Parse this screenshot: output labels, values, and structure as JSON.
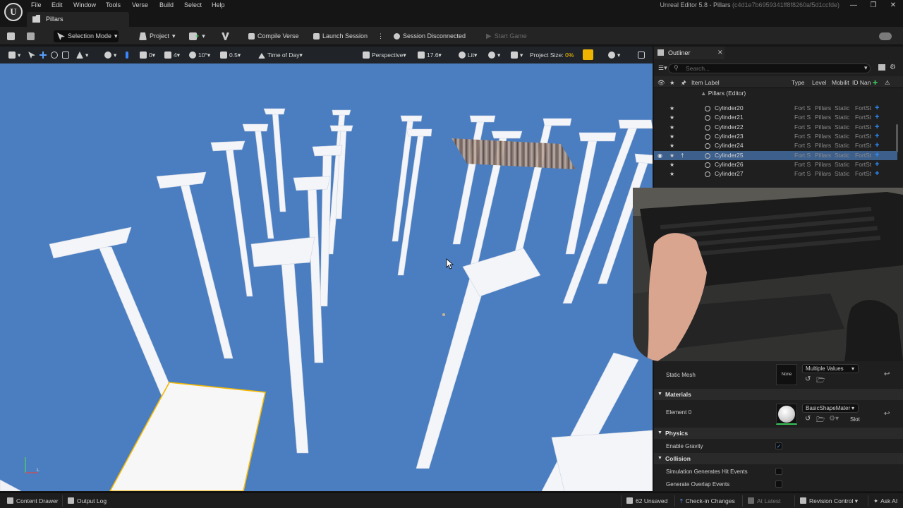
{
  "app": {
    "window_title": "Unreal Editor 5.8 - Pillars",
    "window_hash": "(c4d1e7b6959341ff8f8260af5d1ccfde)",
    "logo_text": "U"
  },
  "menu": {
    "items": [
      "File",
      "Edit",
      "Window",
      "Tools",
      "Verse",
      "Build",
      "Select",
      "Help"
    ]
  },
  "level_tab": {
    "label": "Pillars"
  },
  "toolbar": {
    "mode_label": "Selection Mode",
    "project_label": "Project",
    "compile_label": "Compile Verse",
    "launch_label": "Launch Session",
    "session_status": "Session Disconnected",
    "start_game_label": "Start Game"
  },
  "viewport_toolbar": {
    "grid_snap_value": "0",
    "grid_size_value": "4",
    "rotation_snap_value": "10°",
    "scale_snap_value": "0.5",
    "time_of_day_label": "Time of Day",
    "perspective_label": "Perspective",
    "fov_value": "17.6",
    "lit_label": "Lit",
    "project_size_label": "Project Size:",
    "project_size_value": "0%"
  },
  "outliner": {
    "tab_label": "Outliner",
    "search_placeholder": "Search...",
    "columns": {
      "item_label": "Item Label",
      "type": "Type",
      "level": "Level",
      "mobility": "Mobilit",
      "id_name": "ID Nan"
    },
    "root_label": "Pillars (Editor)",
    "rows": [
      {
        "name": "Cylinder20",
        "type": "Fort S",
        "level": "Pillars",
        "mobility": "Static",
        "id": "FortSt",
        "selected": false
      },
      {
        "name": "Cylinder21",
        "type": "Fort S",
        "level": "Pillars",
        "mobility": "Static",
        "id": "FortSt",
        "selected": false
      },
      {
        "name": "Cylinder22",
        "type": "Fort S",
        "level": "Pillars",
        "mobility": "Static",
        "id": "FortSt",
        "selected": false
      },
      {
        "name": "Cylinder23",
        "type": "Fort S",
        "level": "Pillars",
        "mobility": "Static",
        "id": "FortSt",
        "selected": false
      },
      {
        "name": "Cylinder24",
        "type": "Fort S",
        "level": "Pillars",
        "mobility": "Static",
        "id": "FortSt",
        "selected": false
      },
      {
        "name": "Cylinder25",
        "type": "Fort S",
        "level": "Pillars",
        "mobility": "Static",
        "id": "FortSt",
        "selected": true
      },
      {
        "name": "Cylinder26",
        "type": "Fort S",
        "level": "Pillars",
        "mobility": "Static",
        "id": "FortSt",
        "selected": false
      },
      {
        "name": "Cylinder27",
        "type": "Fort S",
        "level": "Pillars",
        "mobility": "Static",
        "id": "FortSt",
        "selected": false
      }
    ]
  },
  "details": {
    "static_mesh_label": "Static Mesh",
    "static_mesh_thumb": "None",
    "static_mesh_value": "Multiple Values",
    "materials_section": "Materials",
    "element0_label": "Element 0",
    "element0_value": "BasicShapeMater",
    "slot_label": "Slot",
    "physics_section": "Physics",
    "enable_gravity_label": "Enable Gravity",
    "enable_gravity_checked": true,
    "collision_section": "Collision",
    "sim_hit_label": "Simulation Generates Hit Events",
    "overlap_label": "Generate Overlap Events"
  },
  "statusbar": {
    "content_drawer": "Content Drawer",
    "output_log": "Output Log",
    "unsaved": "62 Unsaved",
    "check_in": "Check-in Changes",
    "at_latest": "At Latest",
    "revision_control": "Revision Control",
    "ask_ai": "Ask AI"
  },
  "colors": {
    "viewport_sky": "#4a7ec1",
    "selection_outline": "#f5b800",
    "accent_blue": "#2e8fff",
    "panel": "#1f1f1f"
  }
}
